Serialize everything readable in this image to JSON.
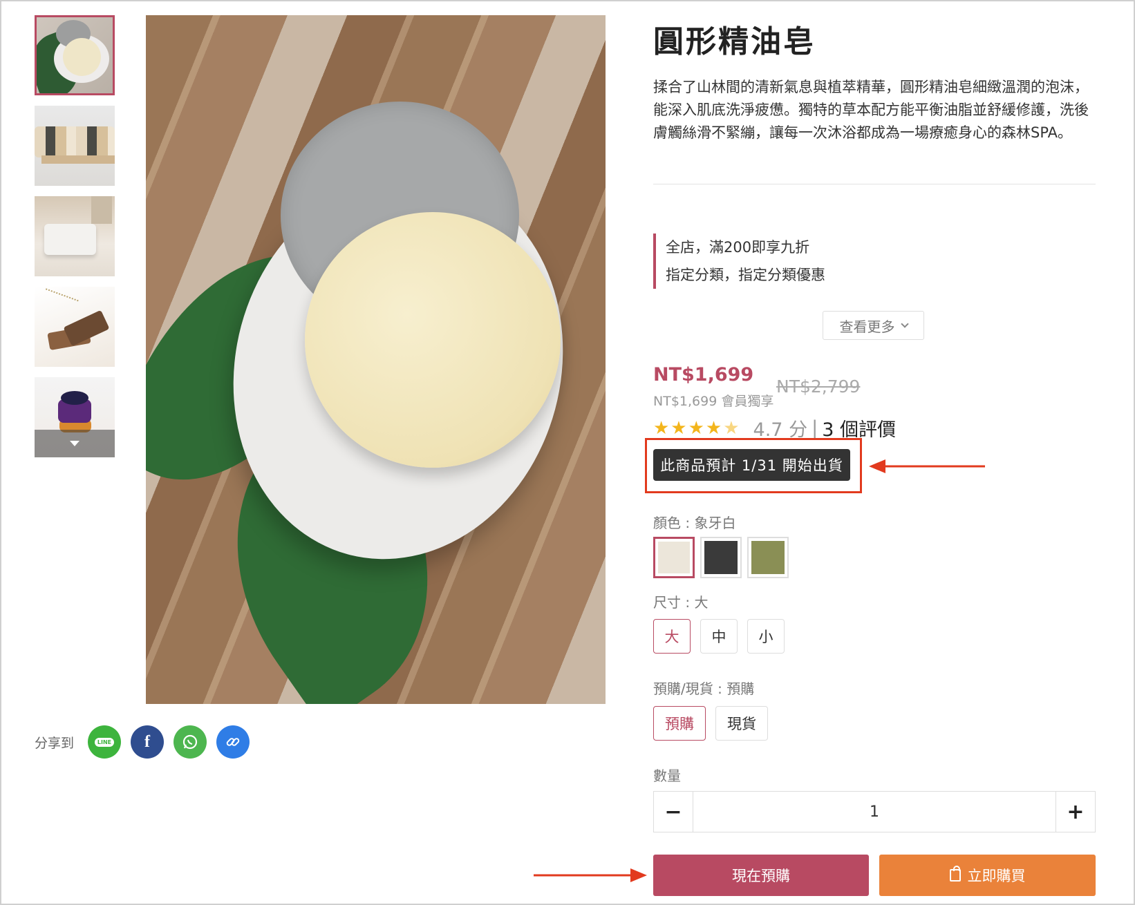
{
  "product": {
    "title": "圓形精油皂",
    "description": "揉合了山林間的清新氣息與植萃精華，圓形精油皂細緻溫潤的泡沫，能深入肌底洗淨疲憊。獨特的草本配方能平衡油脂並舒緩修護，洗後膚觸絲滑不緊繃，讓每一次沐浴都成為一場療癒身心的森林SPA。"
  },
  "promotions": [
    "全店，滿200即享九折",
    "指定分類，指定分類優惠"
  ],
  "see_more_label": "查看更多",
  "pricing": {
    "price": "NT$1,699",
    "original_price": "NT$2,799",
    "member_price": "NT$1,699 會員獨享"
  },
  "rating": {
    "score_value": 4.7,
    "score_text": "4.7 分",
    "separator": "|",
    "reviews": "3 個評價"
  },
  "shipping_notice": "此商品預計 1/31 開始出貨",
  "options": {
    "color_label": "顏色 : 象牙白",
    "colors": [
      {
        "name": "象牙白",
        "hex": "#ece6da",
        "selected": true
      },
      {
        "name": "黑",
        "hex": "#3a3a3a",
        "selected": false
      },
      {
        "name": "橄欖綠",
        "hex": "#8a8f55",
        "selected": false
      }
    ],
    "size_label": "尺寸 : 大",
    "sizes": [
      "大",
      "中",
      "小"
    ],
    "selected_size": "大",
    "stock_label": "預購/現貨 : 預購",
    "stock_types": [
      "預購",
      "現貨"
    ],
    "selected_stock": "預購"
  },
  "quantity": {
    "label": "數量",
    "value": "1",
    "minus": "−",
    "plus": "+"
  },
  "actions": {
    "preorder": "現在預購",
    "buy_now": "立即購買"
  },
  "share": {
    "label": "分享到",
    "networks": [
      "LINE",
      "f",
      "whatsapp-icon",
      "link-icon"
    ]
  },
  "colors": {
    "accent": "#b84a62",
    "buy_button": "#ea823a",
    "annotation": "#e23a1e",
    "star": "#f3b51c"
  }
}
